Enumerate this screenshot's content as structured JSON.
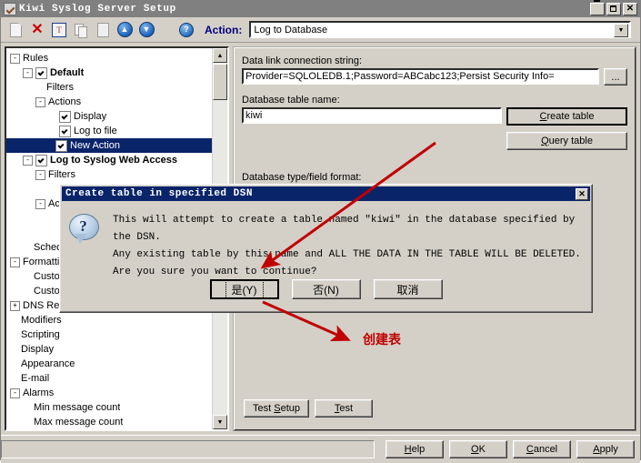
{
  "window": {
    "title": "Kiwi Syslog Server Setup",
    "icon": "kiwi-checkbox-icon",
    "minimize_label": "",
    "maximize_label": "",
    "close_label": "✕"
  },
  "toolbar": {
    "icons": [
      {
        "name": "new-icon"
      },
      {
        "name": "delete-icon",
        "glyph": "✕"
      },
      {
        "name": "rename-icon",
        "glyph": "T"
      },
      {
        "name": "copy-icon"
      },
      {
        "name": "paste-icon"
      },
      {
        "name": "move-up-icon",
        "glyph": "▲"
      },
      {
        "name": "move-down-icon",
        "glyph": "▼"
      },
      {
        "name": "help-icon",
        "glyph": "?"
      }
    ],
    "action_label": "Action:",
    "action_value": "Log to Database",
    "dropdown_glyph": "▼"
  },
  "tree": {
    "items": [
      {
        "label": "Rules",
        "indent": 0,
        "expander": "-",
        "checkbox": null,
        "bold": false,
        "selected": false
      },
      {
        "label": "Default",
        "indent": 1,
        "expander": "-",
        "checkbox": true,
        "bold": true,
        "selected": false
      },
      {
        "label": "Filters",
        "indent": 2,
        "expander": null,
        "checkbox": null,
        "bold": false,
        "selected": false
      },
      {
        "label": "Actions",
        "indent": 2,
        "expander": "-",
        "checkbox": null,
        "bold": false,
        "selected": false
      },
      {
        "label": "Display",
        "indent": 3,
        "expander": null,
        "checkbox": true,
        "bold": false,
        "selected": false
      },
      {
        "label": "Log to file",
        "indent": 3,
        "expander": null,
        "checkbox": true,
        "bold": false,
        "selected": false
      },
      {
        "label": "New Action",
        "indent": 3,
        "expander": null,
        "checkbox": true,
        "bold": false,
        "selected": true
      },
      {
        "label": "Log to Syslog Web Access",
        "indent": 1,
        "expander": "-",
        "checkbox": true,
        "bold": true,
        "selected": false
      },
      {
        "label": "Filters",
        "indent": 2,
        "expander": "-",
        "checkbox": null,
        "bold": false,
        "selected": false
      },
      {
        "label": "",
        "indent": 3,
        "expander": null,
        "checkbox": true,
        "bold": false,
        "selected": false
      },
      {
        "label": "Ac",
        "indent": 2,
        "expander": "-",
        "checkbox": null,
        "bold": false,
        "selected": false
      },
      {
        "label": "",
        "indent": 3,
        "expander": null,
        "checkbox": true,
        "bold": false,
        "selected": false
      },
      {
        "label": "",
        "indent": 3,
        "expander": null,
        "checkbox": true,
        "bold": false,
        "selected": false
      },
      {
        "label": "Schedul",
        "indent": 1,
        "expander": null,
        "checkbox": null,
        "bold": false,
        "selected": false
      },
      {
        "label": "Formattin",
        "indent": 0,
        "expander": "-",
        "checkbox": null,
        "bold": false,
        "selected": false
      },
      {
        "label": "Custo",
        "indent": 1,
        "expander": null,
        "checkbox": null,
        "bold": false,
        "selected": false
      },
      {
        "label": "Custo",
        "indent": 1,
        "expander": null,
        "checkbox": null,
        "bold": false,
        "selected": false
      },
      {
        "label": "DNS Re",
        "indent": 0,
        "expander": "+",
        "checkbox": null,
        "bold": false,
        "selected": false
      },
      {
        "label": "Modifiers",
        "indent": 0,
        "expander": null,
        "checkbox": null,
        "bold": false,
        "selected": false
      },
      {
        "label": "Scripting",
        "indent": 0,
        "expander": null,
        "checkbox": null,
        "bold": false,
        "selected": false
      },
      {
        "label": "Display",
        "indent": 0,
        "expander": null,
        "checkbox": null,
        "bold": false,
        "selected": false
      },
      {
        "label": "Appearance",
        "indent": 0,
        "expander": null,
        "checkbox": null,
        "bold": false,
        "selected": false
      },
      {
        "label": "E-mail",
        "indent": 0,
        "expander": null,
        "checkbox": null,
        "bold": false,
        "selected": false
      },
      {
        "label": "Alarms",
        "indent": 0,
        "expander": "-",
        "checkbox": null,
        "bold": false,
        "selected": false
      },
      {
        "label": "Min message count",
        "indent": 1,
        "expander": null,
        "checkbox": null,
        "bold": false,
        "selected": false
      },
      {
        "label": "Max message count",
        "indent": 1,
        "expander": null,
        "checkbox": null,
        "bold": false,
        "selected": false
      }
    ],
    "scroll_up_glyph": "▲",
    "scroll_down_glyph": "▼"
  },
  "panel": {
    "conn_label": "Data link connection string:",
    "conn_value": "Provider=SQLOLEDB.1;Password=ABCabc123;Persist Security Info=",
    "browse_label": "...",
    "table_label": "Database table name:",
    "table_value": "kiwi",
    "create_table_label": "Create table",
    "query_table_label": "Query table",
    "dbtype_label": "Database type/field format:",
    "test_setup_label": "Test Setup",
    "test_label": "Test"
  },
  "footer": {
    "help_label": "Help",
    "ok_label": "OK",
    "cancel_label": "Cancel",
    "apply_label": "Apply"
  },
  "dialog": {
    "title": "Create table in specified DSN",
    "close_label": "✕",
    "icon": "question-icon",
    "line1": "This will attempt to create a table named \"kiwi\" in the database specified by the DSN.",
    "line2": "Any existing table by this name and ALL THE DATA IN THE TABLE WILL BE DELETED.",
    "line3": "Are you sure you want to continue?",
    "yes_label": "是(Y)",
    "no_label": "否(N)",
    "cancel_label": "取消"
  },
  "annotations": {
    "note_text": "创建表",
    "arrow_color": "#c00000"
  }
}
